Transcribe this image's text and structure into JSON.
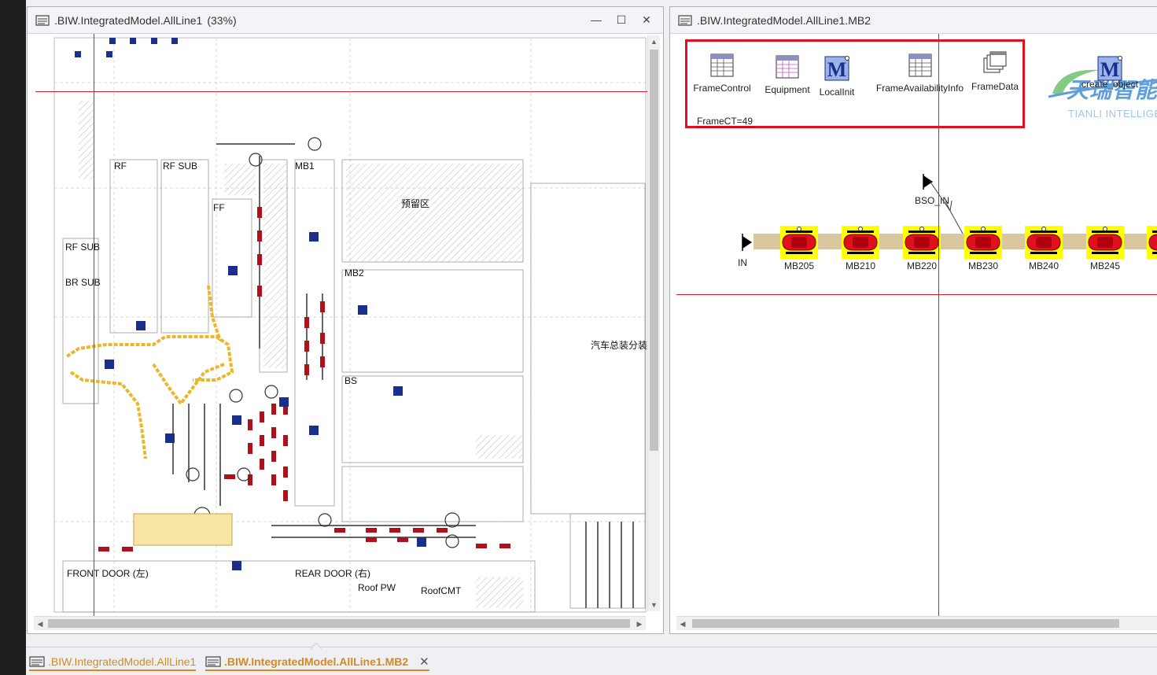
{
  "window_left": {
    "title": ".BIW.IntegratedModel.AllLine1",
    "zoom": "(33%)",
    "controls": {
      "minimize": "—",
      "maximize": "☐",
      "close": "✕"
    }
  },
  "window_right": {
    "title": ".BIW.IntegratedModel.AllLine1.MB2"
  },
  "toolbox": {
    "items": [
      {
        "label": "FrameControl"
      },
      {
        "label": "Equipment"
      },
      {
        "label": "LocalInit"
      },
      {
        "label": "FrameAvailabilityInfo"
      },
      {
        "label": "FrameData"
      }
    ],
    "frame_ct": "FrameCT=49"
  },
  "create_object": {
    "label": "create_object"
  },
  "watermark": {
    "line1": "天瑞智能",
    "line2": "TIANLI INTELLIGE"
  },
  "flow": {
    "entry": "IN",
    "bso": "BSO_IN",
    "stations": [
      "MB205",
      "MB210",
      "MB220",
      "MB230",
      "MB240",
      "MB245",
      "M"
    ]
  },
  "tabs": [
    {
      "label": ".BIW.IntegratedModel.AllLine1"
    },
    {
      "label": ".BIW.IntegratedModel.AllLine1.MB2",
      "close": "✕"
    }
  ],
  "colors": {
    "accent": "#d58a1f",
    "highlight_box": "#e0101e",
    "conveyor": "#d9c7a0",
    "station_yellow": "#ffff00",
    "car_red": "#e0101e",
    "guide_line": "#d21f2b"
  }
}
